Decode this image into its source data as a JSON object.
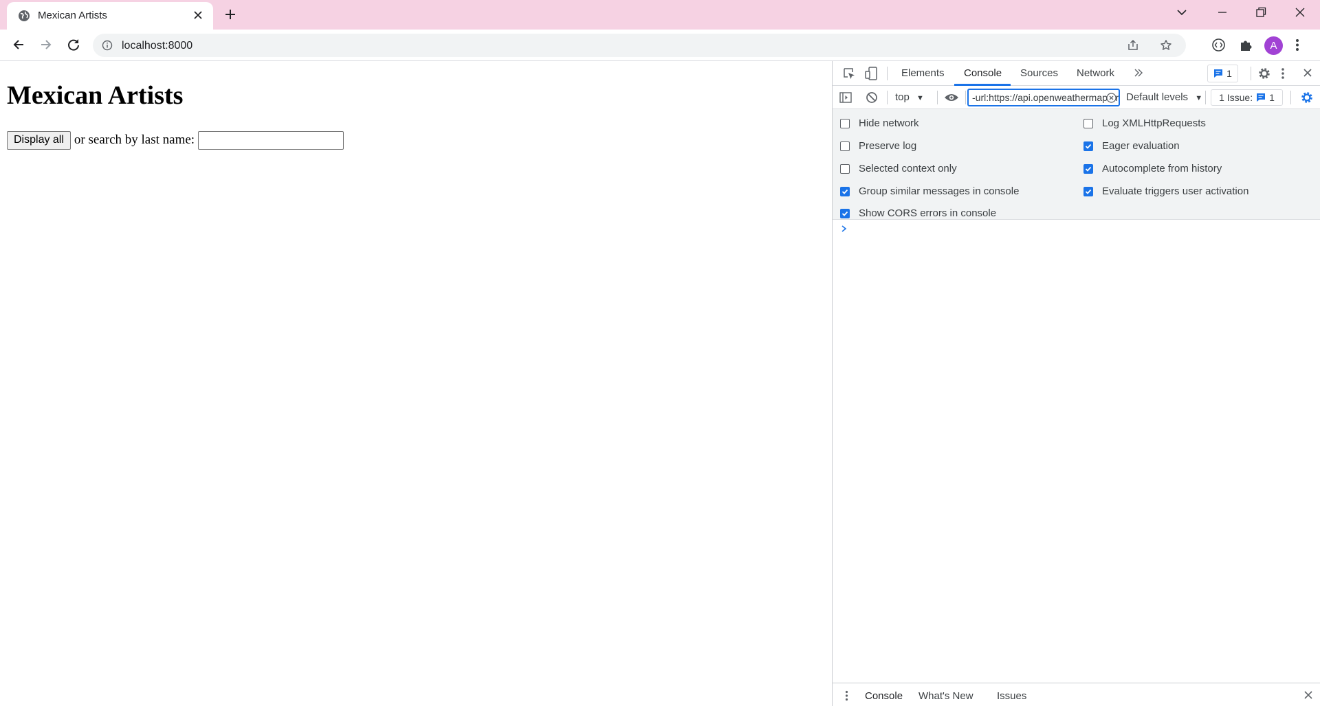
{
  "browser": {
    "tab_title": "Mexican Artists",
    "url": "localhost:8000",
    "avatar_letter": "A",
    "accent": "#1a73e8",
    "frame_color": "#f6d2e3"
  },
  "page": {
    "heading": "Mexican Artists",
    "display_all_label": "Display all",
    "search_text": "or search by last name:",
    "search_value": ""
  },
  "devtools": {
    "tabs": [
      "Elements",
      "Console",
      "Sources",
      "Network"
    ],
    "active_tab": "Console",
    "message_count": "1",
    "context": "top",
    "filter_value": "-url:https://api.openweathermap.org",
    "levels_label": "Default levels",
    "issues_label": "1 Issue:",
    "issues_count": "1",
    "settings": [
      {
        "label": "Hide network",
        "checked": false
      },
      {
        "label": "Log XMLHttpRequests",
        "checked": false
      },
      {
        "label": "Preserve log",
        "checked": false
      },
      {
        "label": "Eager evaluation",
        "checked": true
      },
      {
        "label": "Selected context only",
        "checked": false
      },
      {
        "label": "Autocomplete from history",
        "checked": true
      },
      {
        "label": "Group similar messages in console",
        "checked": true
      },
      {
        "label": "Evaluate triggers user activation",
        "checked": true
      },
      {
        "label": "Show CORS errors in console",
        "checked": true
      }
    ],
    "drawer_tabs": [
      "Console",
      "What's New",
      "Issues"
    ]
  }
}
